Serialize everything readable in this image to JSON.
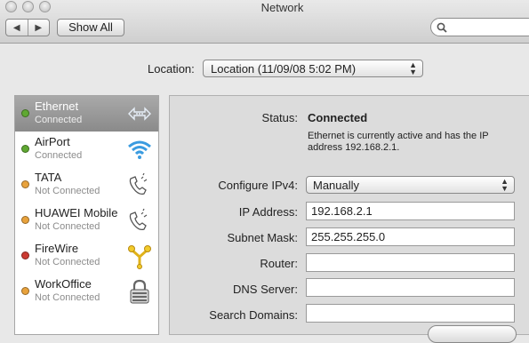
{
  "window": {
    "title": "Network"
  },
  "toolbar": {
    "back_label": "◀",
    "forward_label": "▶",
    "show_all_label": "Show All",
    "search_placeholder": ""
  },
  "location": {
    "label": "Location:",
    "selected": "Location (11/09/08 5:02 PM)"
  },
  "services": [
    {
      "name": "Ethernet",
      "status": "Connected",
      "dot": "#5fa832",
      "icon": "ethernet-arrows-icon",
      "selected": true
    },
    {
      "name": "AirPort",
      "status": "Connected",
      "dot": "#5fa832",
      "icon": "wifi-icon",
      "selected": false
    },
    {
      "name": "TATA",
      "status": "Not Connected",
      "dot": "#e8a23c",
      "icon": "phone-icon",
      "selected": false
    },
    {
      "name": "HUAWEI Mobile",
      "status": "Not Connected",
      "dot": "#e8a23c",
      "icon": "phone-icon",
      "selected": false
    },
    {
      "name": "FireWire",
      "status": "Not Connected",
      "dot": "#cc3a32",
      "icon": "firewire-icon",
      "selected": false
    },
    {
      "name": "WorkOffice",
      "status": "Not Connected",
      "dot": "#e8a23c",
      "icon": "lock-icon",
      "selected": false
    }
  ],
  "detail": {
    "status_label": "Status:",
    "status_value": "Connected",
    "status_desc_line1": "Ethernet is currently active and has the IP",
    "status_desc_line2": "address 192.168.2.1.",
    "configure_label": "Configure IPv4:",
    "configure_value": "Manually",
    "ip_label": "IP Address:",
    "ip_value": "192.168.2.1",
    "subnet_label": "Subnet Mask:",
    "subnet_value": "255.255.255.0",
    "router_label": "Router:",
    "router_value": "",
    "dns_label": "DNS Server:",
    "dns_value": "",
    "search_domains_label": "Search Domains:",
    "search_domains_value": ""
  }
}
